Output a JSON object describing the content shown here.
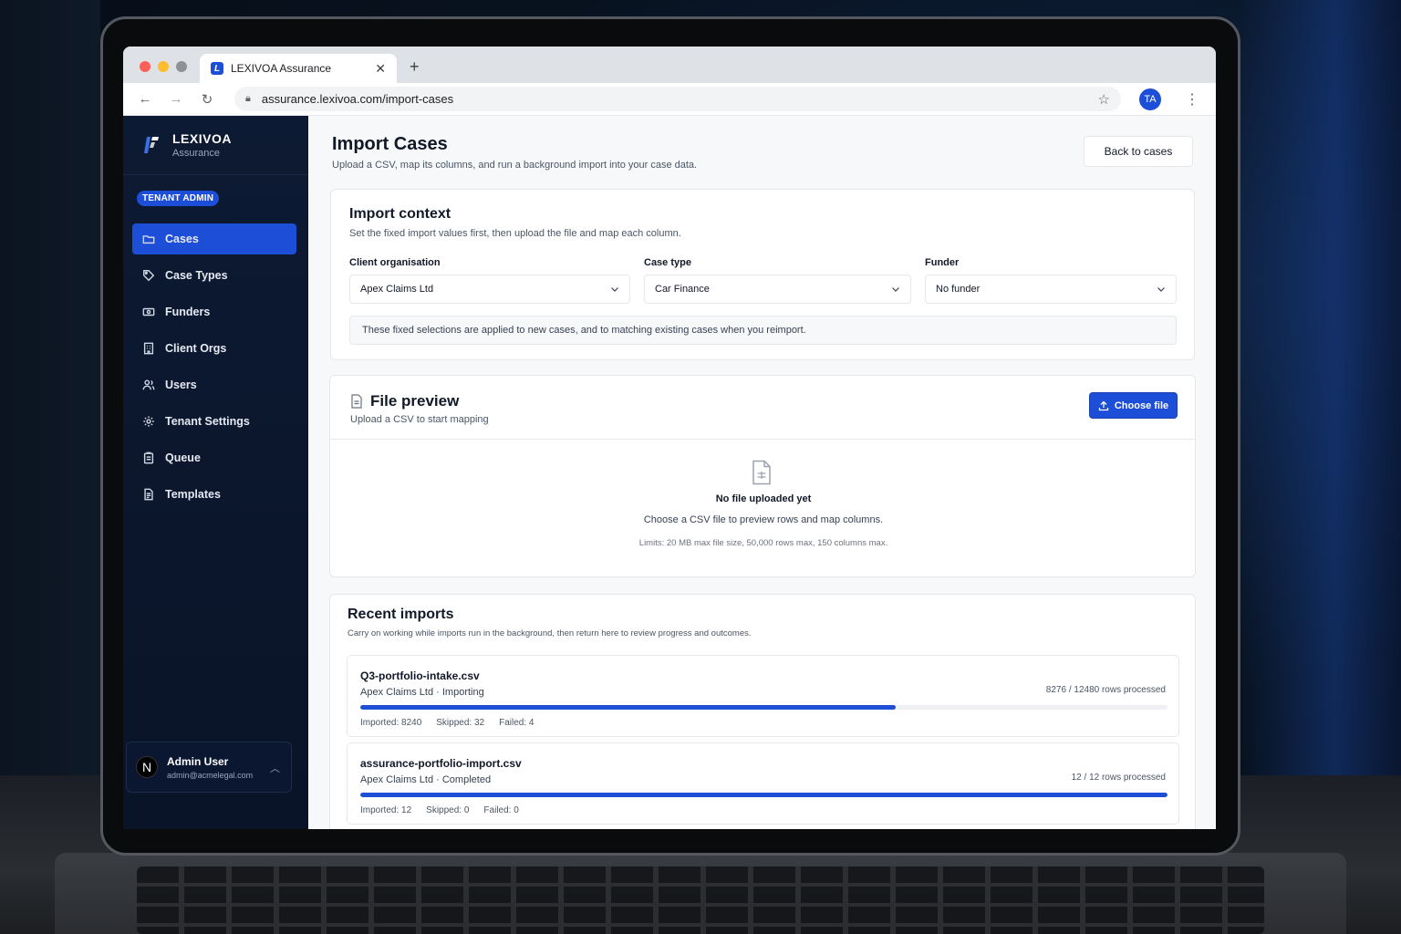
{
  "browser": {
    "tab_title": "LEXIVOA Assurance",
    "url": "assurance.lexivoa.com/import-cases",
    "profile_initials": "TA"
  },
  "brand": {
    "name": "LEXIVOA",
    "sub": "Assurance"
  },
  "role_badge": "TENANT ADMIN",
  "nav": [
    {
      "label": "Cases",
      "icon": "folder-icon",
      "active": true
    },
    {
      "label": "Case Types",
      "icon": "tag-icon"
    },
    {
      "label": "Funders",
      "icon": "banknote-icon"
    },
    {
      "label": "Client Orgs",
      "icon": "building-icon"
    },
    {
      "label": "Users",
      "icon": "users-icon"
    },
    {
      "label": "Tenant Settings",
      "icon": "gear-icon"
    },
    {
      "label": "Queue",
      "icon": "clipboard-icon"
    },
    {
      "label": "Templates",
      "icon": "document-icon"
    }
  ],
  "user": {
    "initial": "N",
    "name": "Admin User",
    "email": "admin@acmelegal.com"
  },
  "page": {
    "title": "Import Cases",
    "subtitle": "Upload a CSV, map its columns, and run a background import into your case data.",
    "back_button": "Back to cases"
  },
  "context": {
    "title": "Import context",
    "subtitle": "Set the fixed import values first, then upload the file and map each column.",
    "client_label": "Client organisation",
    "client_value": "Apex Claims Ltd",
    "case_type_label": "Case type",
    "case_type_value": "Car Finance",
    "funder_label": "Funder",
    "funder_value": "No funder",
    "note": "These fixed selections are applied to new cases, and to matching existing cases when you reimport."
  },
  "file_preview": {
    "title": "File preview",
    "subtitle": "Upload a CSV to start mapping",
    "choose_button": "Choose file",
    "empty_title": "No file uploaded yet",
    "empty_desc": "Choose a CSV file to preview rows and map columns.",
    "limits": "Limits: 20 MB max file size, 50,000 rows max, 150 columns max."
  },
  "recent": {
    "title": "Recent imports",
    "subtitle": "Carry on working while imports run in the background, then return here to review progress and outcomes.",
    "imports": [
      {
        "file": "Q3-portfolio-intake.csv",
        "meta": "Apex Claims Ltd · Importing",
        "rows": "8276 / 12480 rows processed",
        "progress": 0.663,
        "imported": "Imported: 8240",
        "skipped": "Skipped: 32",
        "failed": "Failed: 4"
      },
      {
        "file": "assurance-portfolio-import.csv",
        "meta": "Apex Claims Ltd · Completed",
        "rows": "12 / 12 rows processed",
        "progress": 1.0,
        "imported": "Imported: 12",
        "skipped": "Skipped: 0",
        "failed": "Failed: 0"
      }
    ]
  },
  "colors": {
    "accent": "#1d4ed8",
    "sidebar": "#0d1a33"
  }
}
